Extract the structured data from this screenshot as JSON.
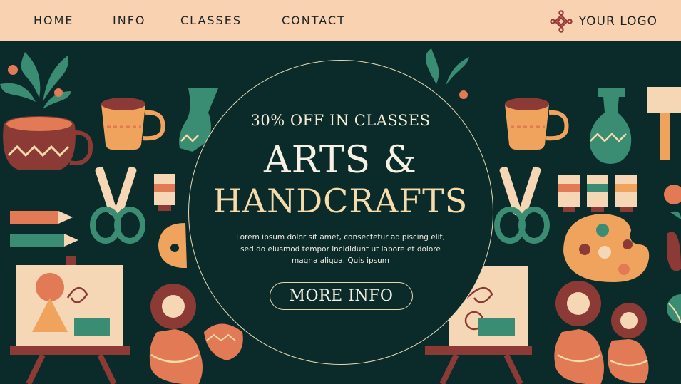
{
  "nav": {
    "home": "HOME",
    "info": "INFO",
    "classes": "CLASSES",
    "contact": "CONTACT"
  },
  "logo": {
    "text": "YOUR LOGO",
    "icon": "knot-icon"
  },
  "hero": {
    "promo": "30% OFF IN CLASSES",
    "title_line1": "ARTS &",
    "title_line2": "HANDCRAFTS",
    "body": "Lorem ipsum dolor sit amet, consectetur adipiscing elit, sed do eiusmod tempor incididunt ut labore et dolore magna aliqua. Quis ipsum",
    "cta": "MORE INFO"
  },
  "colors": {
    "nav_bg": "#f9d2b2",
    "hero_bg": "#0b2a2a",
    "accent_cream": "#f5dcaa",
    "terracotta": "#e27a55",
    "teal": "#3a8c73",
    "maroon": "#8c3a36"
  }
}
